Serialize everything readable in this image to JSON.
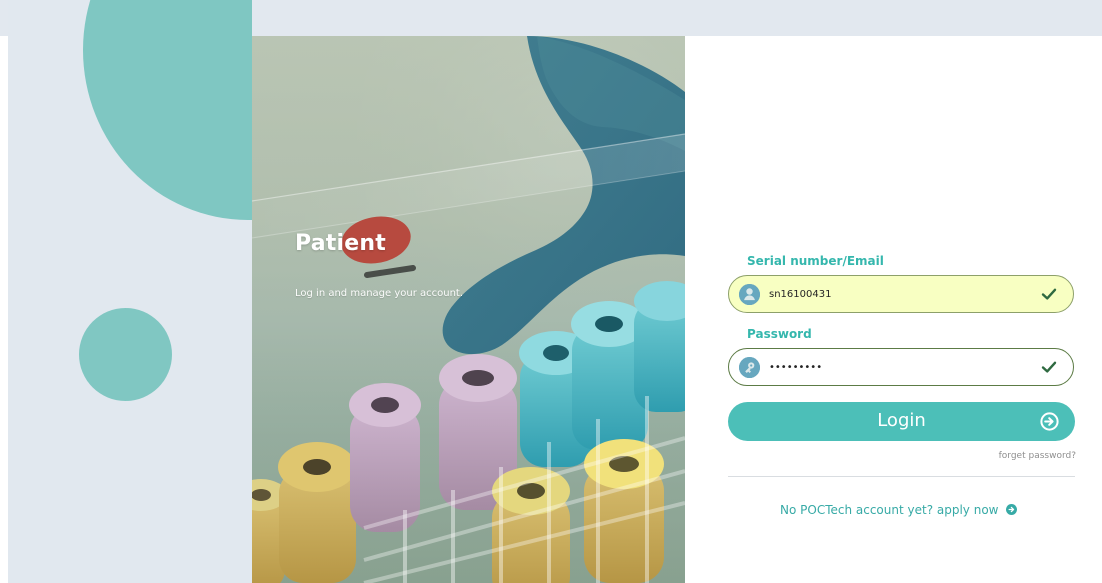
{
  "hero": {
    "title": "Patient",
    "subtitle": "Log in and manage your account."
  },
  "form": {
    "serial_label": "Serial number/Email",
    "serial_value": "sn16100431",
    "password_label": "Password",
    "password_value": "•••••••••",
    "login_label": "Login",
    "forgot_label": "forget password?",
    "apply_label": "No POCTech account yet? apply now"
  },
  "icons": {
    "user": "user-icon",
    "key": "key-icon",
    "check": "check-icon",
    "arrow": "arrow-right-circle-icon"
  },
  "colors": {
    "accent": "#4cbfb8",
    "label": "#35b7ad",
    "circle": "#7fc7c2",
    "autofill": "#f8ffc2"
  }
}
